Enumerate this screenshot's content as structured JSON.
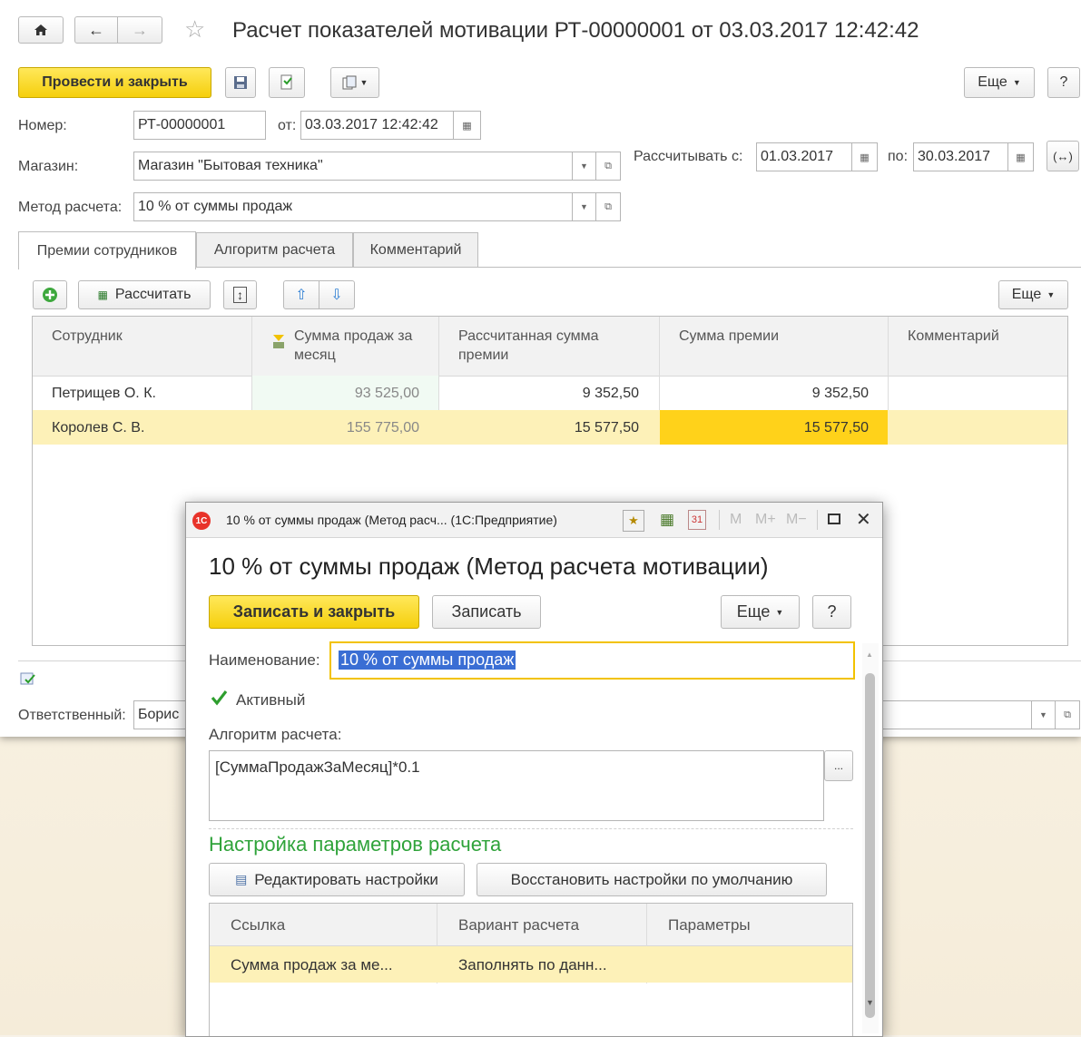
{
  "main_form": {
    "title": "Расчет показателей мотивации РТ-00000001 от 03.03.2017 12:42:42",
    "toolbar": {
      "post_and_close": "Провести и закрыть",
      "more": "Еще",
      "help": "?"
    },
    "fields": {
      "number_label": "Номер:",
      "number_value": "РТ-00000001",
      "date_label": "от:",
      "date_value": "03.03.2017 12:42:42",
      "store_label": "Магазин:",
      "store_value": "Магазин \"Бытовая техника\"",
      "calc_from_label": "Рассчитывать с:",
      "calc_from_value": "01.03.2017",
      "calc_to_label": "по:",
      "calc_to_value": "30.03.2017",
      "method_label": "Метод расчета:",
      "method_value": "10 % от суммы продаж",
      "responsible_label": "Ответственный:",
      "responsible_value": "Борис"
    },
    "tabs": [
      "Премии сотрудников",
      "Алгоритм расчета",
      "Комментарий"
    ],
    "table_toolbar": {
      "calculate": "Рассчитать",
      "more": "Еще"
    },
    "table": {
      "columns": [
        "Сотрудник",
        "Сумма продаж за месяц",
        "Рассчитанная сумма премии",
        "Сумма премии",
        "Комментарий"
      ],
      "rows": [
        {
          "employee": "Петрищев О. К.",
          "sales": "93 525,00",
          "calculated": "9 352,50",
          "bonus": "9 352,50",
          "comment": ""
        },
        {
          "employee": "Королев С. В.",
          "sales": "155 775,00",
          "calculated": "15 577,50",
          "bonus": "15 577,50",
          "comment": ""
        }
      ]
    }
  },
  "dialog": {
    "window_title": "10 % от суммы продаж (Метод расч... (1С:Предприятие)",
    "title_buttons": [
      "M",
      "M+",
      "M−"
    ],
    "heading": "10 % от суммы продаж (Метод расчета мотивации)",
    "toolbar": {
      "save_and_close": "Записать и закрыть",
      "save": "Записать",
      "more": "Еще",
      "help": "?"
    },
    "name_label": "Наименование:",
    "name_value": "10 % от суммы продаж",
    "active_label": "Активный",
    "algorithm_label": "Алгоритм расчета:",
    "algorithm_value": "[СуммаПродажЗаМесяц]*0.1",
    "ellipsis": "...",
    "params_heading": "Настройка параметров расчета",
    "edit_settings": "Редактировать настройки",
    "restore_defaults": "Восстановить настройки по умолчанию",
    "params_table": {
      "columns": [
        "Ссылка",
        "Вариант расчета",
        "Параметры"
      ],
      "rows": [
        {
          "link": "Сумма продаж за ме...",
          "variant": "Заполнять по данн...",
          "params": ""
        }
      ]
    }
  },
  "colors": {
    "accent_yellow": "#f9d92a",
    "selected_row": "#fdf3c0",
    "highlight_cell": "#ffd21a",
    "green_heading": "#2fa33a"
  }
}
